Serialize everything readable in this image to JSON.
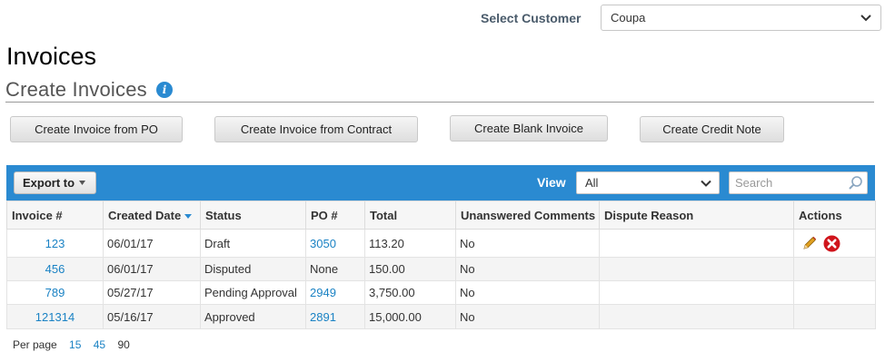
{
  "customer": {
    "label": "Select Customer",
    "value": "Coupa"
  },
  "page": {
    "title": "Invoices",
    "subtitle": "Create Invoices",
    "info_icon": "info-icon"
  },
  "actions": {
    "from_po": "Create Invoice from PO",
    "from_contract": "Create Invoice from Contract",
    "blank": "Create Blank Invoice",
    "credit_note": "Create Credit Note"
  },
  "toolbar": {
    "export_label": "Export to",
    "view_label": "View",
    "view_value": "All",
    "search_placeholder": "Search",
    "bar_color": "#2a8ad1"
  },
  "table": {
    "columns": [
      "Invoice #",
      "Created Date",
      "Status",
      "PO #",
      "Total",
      "Unanswered Comments",
      "Dispute Reason",
      "Actions"
    ],
    "sorted_column": "Created Date",
    "rows": [
      {
        "invoice": "123",
        "date": "06/01/17",
        "status": "Draft",
        "po": "3050",
        "total": "113.20",
        "comments": "No",
        "dispute": "",
        "actions": [
          "edit-icon",
          "delete-icon"
        ]
      },
      {
        "invoice": "456",
        "date": "06/01/17",
        "status": "Disputed",
        "po": "None",
        "total": "150.00",
        "comments": "No",
        "dispute": ""
      },
      {
        "invoice": "789",
        "date": "05/27/17",
        "status": "Pending Approval",
        "po": "2949",
        "total": "3,750.00",
        "comments": "No",
        "dispute": ""
      },
      {
        "invoice": "121314",
        "date": "05/16/17",
        "status": "Approved",
        "po": "2891",
        "total": "15,000.00",
        "comments": "No",
        "dispute": ""
      }
    ]
  },
  "pagination": {
    "label": "Per page",
    "options": [
      "15",
      "45",
      "90"
    ],
    "selected": "90"
  }
}
